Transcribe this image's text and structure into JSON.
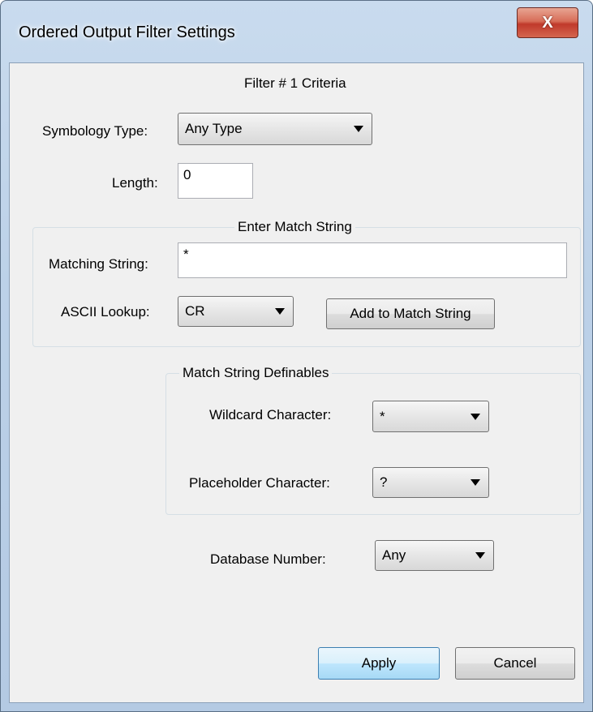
{
  "window": {
    "title": "Ordered Output Filter Settings",
    "close_label": "X"
  },
  "filter_heading": "Filter # 1 Criteria",
  "symbology": {
    "label": "Symbology Type:",
    "value": "Any Type"
  },
  "length": {
    "label": "Length:",
    "value": "0"
  },
  "match_group": {
    "title": "Enter Match String",
    "matching_label": "Matching String:",
    "matching_value": "*",
    "ascii_label": "ASCII Lookup:",
    "ascii_value": "CR",
    "add_button": "Add to Match String"
  },
  "definables": {
    "title": "Match String Definables",
    "wildcard_label": "Wildcard Character:",
    "wildcard_value": "*",
    "placeholder_label": "Placeholder Character:",
    "placeholder_value": "?"
  },
  "database": {
    "label": "Database Number:",
    "value": "Any"
  },
  "buttons": {
    "apply": "Apply",
    "cancel": "Cancel"
  }
}
